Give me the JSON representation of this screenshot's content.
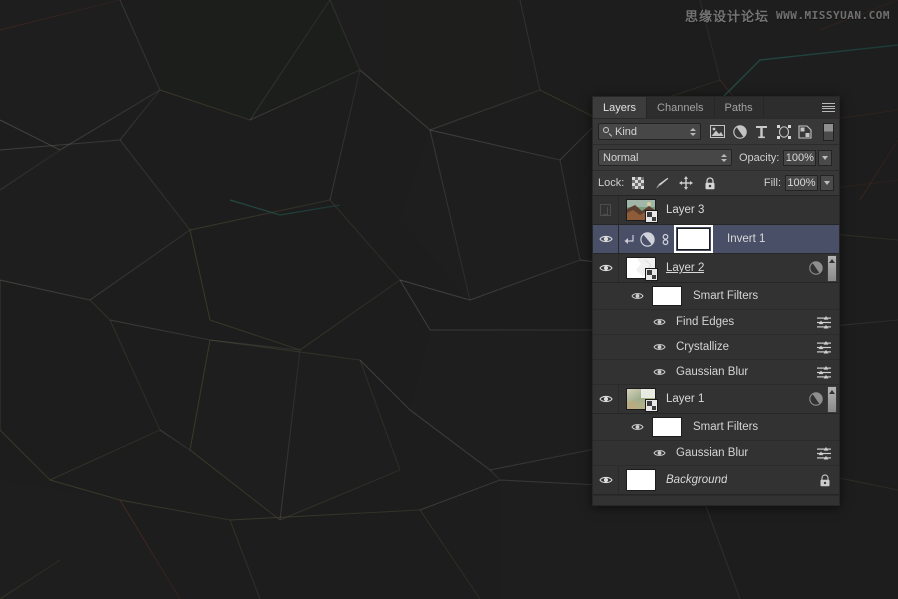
{
  "watermark": {
    "cn_text": "思缘设计论坛",
    "en_text": "WWW.MISSYUAN.COM"
  },
  "panel": {
    "tabs": [
      {
        "label": "Layers",
        "active": true
      },
      {
        "label": "Channels",
        "active": false
      },
      {
        "label": "Paths",
        "active": false
      }
    ],
    "menu_icon": "hamburger-menu-icon",
    "filter": {
      "kind_label": "Kind",
      "search_icon": "magnifier-icon",
      "icons": [
        "pixel-layer-filter-icon",
        "adjustment-layer-filter-icon",
        "type-layer-filter-icon",
        "shape-layer-filter-icon",
        "smart-object-filter-icon"
      ],
      "toggle_icon": "filter-enable-toggle"
    },
    "blend": {
      "mode": "Normal",
      "opacity_label": "Opacity:",
      "opacity_value": "100%",
      "fill_label": "Fill:",
      "fill_value": "100%"
    },
    "lock": {
      "label": "Lock:",
      "icons": [
        "lock-transparent-pixels-icon",
        "lock-image-pixels-icon",
        "lock-position-icon",
        "lock-all-icon"
      ]
    },
    "layers": [
      {
        "id": "layer-3",
        "name": "Layer 3",
        "visible": false,
        "selected": false,
        "thumb_type": "photo-colorful",
        "smart_object": true,
        "italic": false,
        "underline": false,
        "locked": false,
        "has_expand_handle": false
      },
      {
        "id": "invert-1",
        "name": "Invert 1",
        "visible": true,
        "selected": true,
        "thumb_type": "mask-white",
        "smart_object": false,
        "italic": false,
        "underline": false,
        "locked": false,
        "clipping_mask_icon": "clipping-mask-arrow-icon",
        "adjustment_icon": "invert-adjustment-icon",
        "link_icon": "link-mask-icon",
        "has_expand_handle": false
      },
      {
        "id": "layer-2",
        "name": "Layer 2",
        "visible": true,
        "selected": false,
        "thumb_type": "white-partial",
        "smart_object": true,
        "italic": false,
        "underline": true,
        "locked": false,
        "has_expand_handle": true,
        "smart_filter_badge": "smart-filter-indicator-icon",
        "smart_filters": {
          "header_label": "Smart Filters",
          "items": [
            {
              "name": "Find Edges",
              "visible": true
            },
            {
              "name": "Crystallize",
              "visible": true
            },
            {
              "name": "Gaussian Blur",
              "visible": true
            }
          ]
        }
      },
      {
        "id": "layer-1",
        "name": "Layer 1",
        "visible": true,
        "selected": false,
        "thumb_type": "gradient-green-tan",
        "smart_object": true,
        "italic": false,
        "underline": false,
        "locked": false,
        "has_expand_handle": true,
        "smart_filter_badge": "smart-filter-indicator-icon",
        "smart_filters": {
          "header_label": "Smart Filters",
          "items": [
            {
              "name": "Gaussian Blur",
              "visible": true
            }
          ]
        }
      },
      {
        "id": "background",
        "name": "Background",
        "visible": true,
        "selected": false,
        "thumb_type": "white",
        "smart_object": false,
        "italic": true,
        "underline": false,
        "locked": true,
        "has_expand_handle": false
      }
    ]
  },
  "colors": {
    "panel_bg": "#323232",
    "panel_header_bg": "#383838",
    "selected_row": "#4a4f68",
    "text": "#d9d9d9",
    "canvas_bg": "#1c1d1c",
    "accent_teal": "#2f6e63",
    "accent_tan": "#8a7d55",
    "accent_red": "#7a3b33"
  }
}
